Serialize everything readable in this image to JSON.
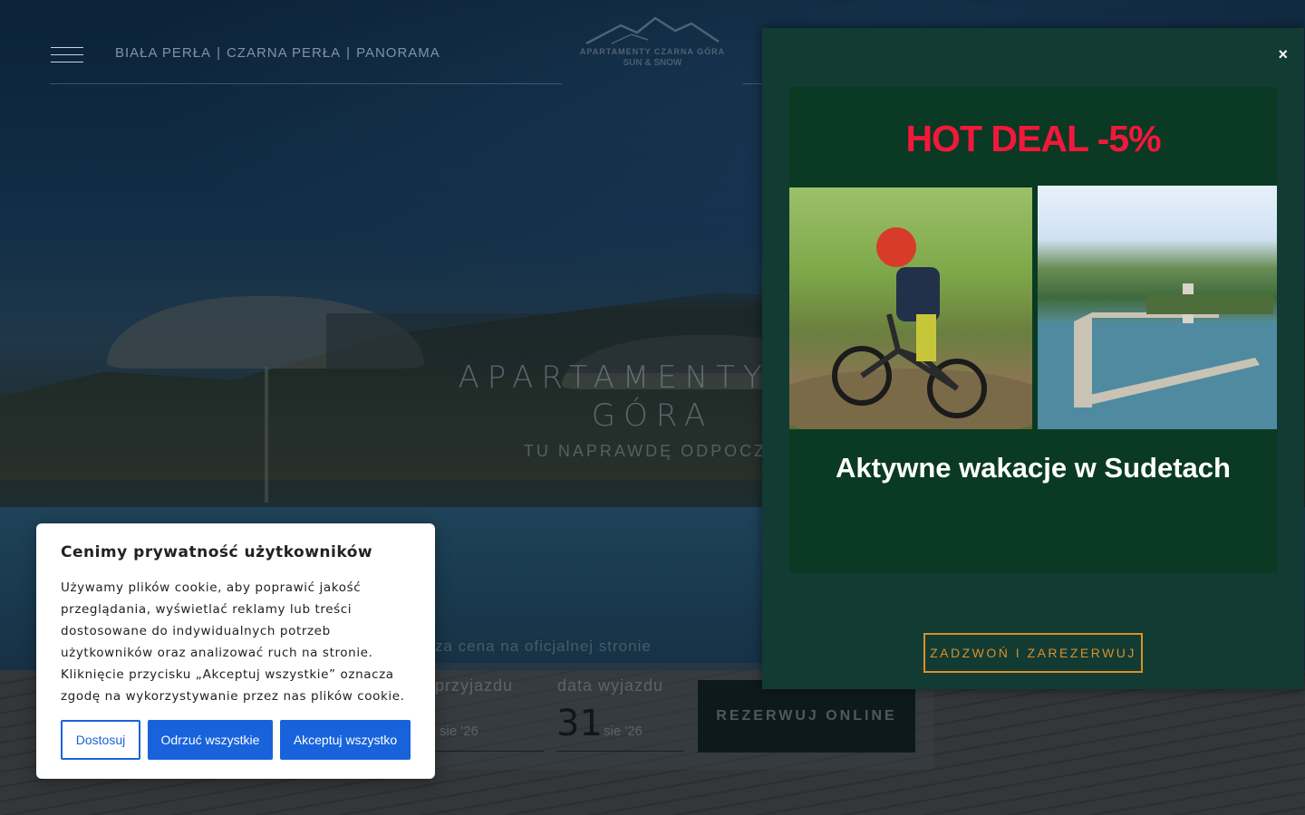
{
  "header": {
    "nav_items": [
      {
        "label": "BIAŁA PERŁA"
      },
      {
        "label": "CZARNA PERŁA"
      },
      {
        "label": "PANORAMA"
      }
    ],
    "separator": "|",
    "logo_line1": "APARTAMENTY CZARNA GÓRA",
    "logo_line2": "SUN & SNOW"
  },
  "hero": {
    "title_line1": "APARTAMENTY CZ",
    "title_line2": "GÓRA",
    "subtitle": "TU NAPRAWDĘ ODPOCZN"
  },
  "booking": {
    "price_note": "za cena na oficjalnej stronie",
    "arrival_label": "przyjazdu",
    "arrival_month": "sie '26",
    "departure_label": "data wyjazdu",
    "departure_day": "31",
    "departure_month": "sie '26",
    "book_button": "REZERWUJ ONLINE"
  },
  "promo": {
    "close_label": "×",
    "deal_text": "HOT DEAL -5%",
    "tagline": "Aktywne wakacje w Sudetach",
    "cta_label": "ZADZWOŃ I ZAREZERWUJ",
    "colors": {
      "panel": "#123b33",
      "banner": "#0a3a23",
      "deal": "#f2183b",
      "cta": "#d9902b"
    }
  },
  "cookie": {
    "title": "Cenimy prywatność użytkowników",
    "body": "Używamy plików cookie, aby poprawić jakość przeglądania, wyświetlać reklamy lub treści dostosowane do indywidualnych potrzeb użytkowników oraz analizować ruch na stronie. Kliknięcie przycisku „Akceptuj wszystkie” oznacza zgodę na wykorzystywanie przez nas plików cookie.",
    "customize_label": "Dostosuj",
    "reject_label": "Odrzuć wszystkie",
    "accept_label": "Akceptuj wszystko",
    "accent_color": "#1863dc"
  }
}
